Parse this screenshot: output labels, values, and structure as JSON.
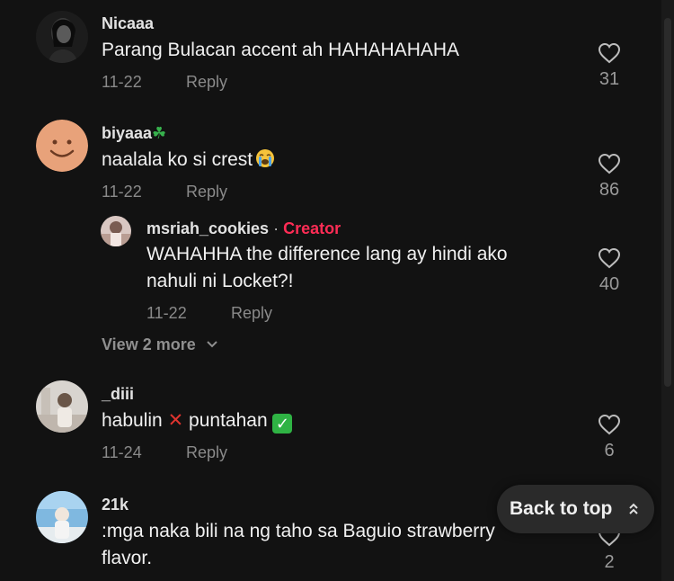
{
  "comments": [
    {
      "username": "Nicaaa",
      "text": "Parang Bulacan accent ah HAHAHAHAHA",
      "date": "11-22",
      "reply_label": "Reply",
      "likes": "31",
      "avatar_icon": "dark-portrait-avatar"
    },
    {
      "username": "biyaaa",
      "username_emoji": "☘",
      "text": "naalala ko si crest",
      "text_emoji": "😭",
      "date": "11-22",
      "reply_label": "Reply",
      "likes": "86",
      "avatar_icon": "smiley-face-avatar",
      "reply": {
        "username": "msriah_cookies",
        "separator": "·",
        "creator_badge": "Creator",
        "text_line1": "WAHAHHA the difference lang ay hindi ako",
        "text_line2": "nahuli ni Locket?!",
        "date": "11-22",
        "reply_label": "Reply",
        "likes": "40",
        "avatar_icon": "cookie-photo-avatar"
      },
      "view_more": "View 2 more"
    },
    {
      "username": "_diii",
      "text_before": "habulin",
      "cross_emoji": "✕",
      "text_middle": "puntahan",
      "check_emoji": "✓",
      "date": "11-24",
      "reply_label": "Reply",
      "likes": "6",
      "avatar_icon": "light-photo-avatar"
    },
    {
      "username": "21k",
      "text_line1": ":mga naka bili na ng taho sa Baguio strawberry",
      "text_line2": "flavor.",
      "likes": "2",
      "avatar_icon": "sky-photo-avatar"
    }
  ],
  "back_to_top": {
    "label": "Back to top",
    "icon": "double-chevron-up-icon"
  },
  "colors": {
    "background": "#121212",
    "creator": "#fe2c55",
    "meta": "#8a8a8a",
    "cross": "#e0342f",
    "check": "#2fb344"
  }
}
